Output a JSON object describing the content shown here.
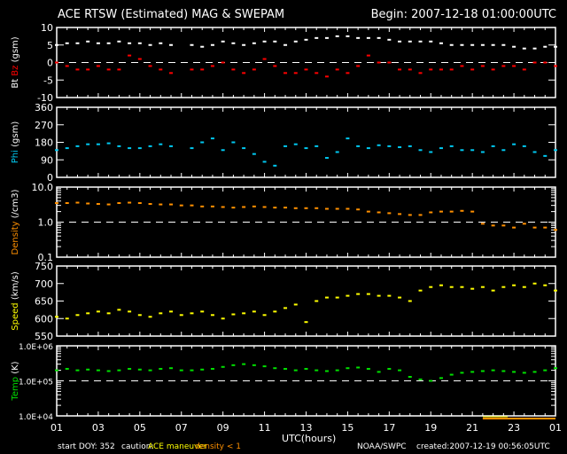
{
  "header": {
    "title": "ACE RTSW (Estimated) MAG & SWEPAM",
    "begin": "Begin: 2007-12-18 01:00:00UTC"
  },
  "footer": {
    "xlabel": "UTC(hours)",
    "start_doy": "start DOY: 352",
    "caution": "caution:",
    "ace_maneuver": "ACE maneuver",
    "density_lt1": "density < 1",
    "org": "NOAA/SWPC",
    "created": "created:2007-12-19 00:56:05UTC"
  },
  "colors": {
    "bt": "#ffffff",
    "bz": "#ff0000",
    "phi": "#00c8f0",
    "density": "#ff9000",
    "speed": "#ffff00",
    "temp": "#00e000",
    "maneuver": "#ffff00"
  },
  "chart_data": {
    "type": "scatter",
    "x_tick_labels": [
      "01",
      "03",
      "05",
      "07",
      "09",
      "11",
      "13",
      "15",
      "17",
      "19",
      "21",
      "23",
      "01"
    ],
    "x_start_hour_utc": 1,
    "x_step_hours": 0.5,
    "density_caution_hours": [
      20.5,
      24
    ],
    "panels": [
      {
        "ylabel": [
          {
            "text": "Bt",
            "color": "#ffffff"
          },
          {
            "text": "Bz",
            "color": "#ff0000"
          },
          {
            "text": "(gsm)",
            "color": "#ffffff"
          }
        ],
        "scale": "linear",
        "ylim": [
          -10,
          10
        ],
        "yticks": [
          "10",
          "5",
          "0",
          "-5",
          "-10"
        ],
        "ytick_values": [
          10,
          5,
          0,
          -5,
          -10
        ],
        "dashed_at": 0,
        "series": [
          {
            "name": "Bt",
            "color": "#ffffff",
            "values": [
              5,
              5.5,
              5.5,
              6,
              5.5,
              5.5,
              6,
              5.5,
              5.5,
              5,
              5.5,
              5,
              null,
              5,
              4.5,
              5,
              6,
              5.5,
              5,
              5.5,
              6,
              6,
              5,
              6,
              6.5,
              7,
              7,
              7.5,
              7.5,
              7,
              7,
              7,
              6.5,
              6,
              6,
              6,
              6,
              5.5,
              5,
              5,
              5,
              5,
              5,
              5,
              4.5,
              4,
              4,
              4.5,
              4.5
            ]
          },
          {
            "name": "Bz",
            "color": "#ff0000",
            "values": [
              0,
              -1,
              -2,
              -2,
              -1,
              -2,
              -2,
              2,
              1,
              -1,
              -2,
              -3,
              null,
              -2,
              -2,
              -1,
              0,
              -2,
              -3,
              -2,
              1,
              -1,
              -3,
              -3,
              -2,
              -3,
              -4,
              -2,
              -3,
              -1,
              2,
              0,
              0,
              -2,
              -2,
              -3,
              -2,
              -2,
              -2,
              -1,
              -2,
              -1,
              -2,
              -1,
              -1,
              -2,
              0,
              0,
              -1
            ]
          }
        ]
      },
      {
        "ylabel": [
          {
            "text": "Phi",
            "color": "#00c8f0"
          },
          {
            "text": "(gsm)",
            "color": "#ffffff"
          }
        ],
        "scale": "linear",
        "ylim": [
          0,
          360
        ],
        "yticks": [
          "360",
          "270",
          "180",
          "90",
          "0"
        ],
        "ytick_values": [
          360,
          270,
          180,
          90,
          0
        ],
        "dashed_at": null,
        "series": [
          {
            "name": "Phi",
            "color": "#00c8f0",
            "values": [
              140,
              150,
              160,
              170,
              170,
              175,
              160,
              150,
              150,
              160,
              170,
              160,
              null,
              150,
              180,
              200,
              140,
              180,
              150,
              120,
              80,
              60,
              160,
              170,
              150,
              160,
              100,
              130,
              200,
              160,
              150,
              165,
              160,
              155,
              160,
              140,
              130,
              150,
              160,
              140,
              140,
              130,
              160,
              140,
              170,
              160,
              130,
              110,
              140
            ]
          }
        ]
      },
      {
        "ylabel": [
          {
            "text": "Density",
            "color": "#ff9000"
          },
          {
            "text": "(/cm3)",
            "color": "#ffffff"
          }
        ],
        "scale": "log",
        "ylim": [
          0.1,
          10
        ],
        "yticks": [
          "10.0",
          "1.0",
          "0.1"
        ],
        "ytick_values": [
          10,
          1,
          0.1
        ],
        "dashed_at": 1,
        "series": [
          {
            "name": "Density",
            "color": "#ff9000",
            "values": [
              3.5,
              3.5,
              3.6,
              3.4,
              3.3,
              3.2,
              3.5,
              3.6,
              3.5,
              3.3,
              3.2,
              3.2,
              3.0,
              3.0,
              2.8,
              2.8,
              2.7,
              2.6,
              2.7,
              2.8,
              2.7,
              2.6,
              2.6,
              2.5,
              2.5,
              2.5,
              2.4,
              2.4,
              2.4,
              2.3,
              2.0,
              1.9,
              1.8,
              1.7,
              1.6,
              1.6,
              1.9,
              2.0,
              2.0,
              2.1,
              2.0,
              0.9,
              0.8,
              0.8,
              0.7,
              0.9,
              0.7,
              0.7,
              0.6
            ]
          }
        ]
      },
      {
        "ylabel": [
          {
            "text": "Speed",
            "color": "#ffff00"
          },
          {
            "text": "(km/s)",
            "color": "#ffffff"
          }
        ],
        "scale": "linear",
        "ylim": [
          550,
          750
        ],
        "yticks": [
          "750",
          "700",
          "650",
          "600",
          "550"
        ],
        "ytick_values": [
          750,
          700,
          650,
          600,
          550
        ],
        "dashed_at": null,
        "series": [
          {
            "name": "Speed",
            "color": "#ffff00",
            "values": [
              605,
              600,
              610,
              615,
              620,
              615,
              625,
              620,
              610,
              605,
              615,
              620,
              610,
              615,
              620,
              610,
              600,
              612,
              615,
              620,
              610,
              620,
              630,
              640,
              590,
              650,
              660,
              660,
              665,
              670,
              670,
              665,
              665,
              660,
              650,
              680,
              690,
              695,
              690,
              690,
              685,
              690,
              680,
              690,
              695,
              690,
              700,
              695,
              680
            ]
          }
        ]
      },
      {
        "ylabel": [
          {
            "text": "Temp",
            "color": "#00e000"
          },
          {
            "text": "(K)",
            "color": "#ffffff"
          }
        ],
        "scale": "log",
        "ylim": [
          10000,
          1000000
        ],
        "yticks": [
          "1.0E+06",
          "1.0E+05",
          "1.0E+04"
        ],
        "ytick_values": [
          1000000,
          100000,
          10000
        ],
        "dashed_at": 100000,
        "series": [
          {
            "name": "Temp",
            "color": "#00e000",
            "values": [
              200000,
              220000,
              200000,
              210000,
              200000,
              190000,
              200000,
              220000,
              210000,
              200000,
              220000,
              230000,
              200000,
              200000,
              210000,
              220000,
              250000,
              280000,
              300000,
              280000,
              260000,
              230000,
              220000,
              200000,
              220000,
              200000,
              190000,
              200000,
              230000,
              240000,
              220000,
              180000,
              220000,
              200000,
              130000,
              110000,
              100000,
              120000,
              150000,
              170000,
              180000,
              190000,
              200000,
              190000,
              180000,
              170000,
              180000,
              200000,
              230000
            ]
          }
        ]
      }
    ]
  }
}
